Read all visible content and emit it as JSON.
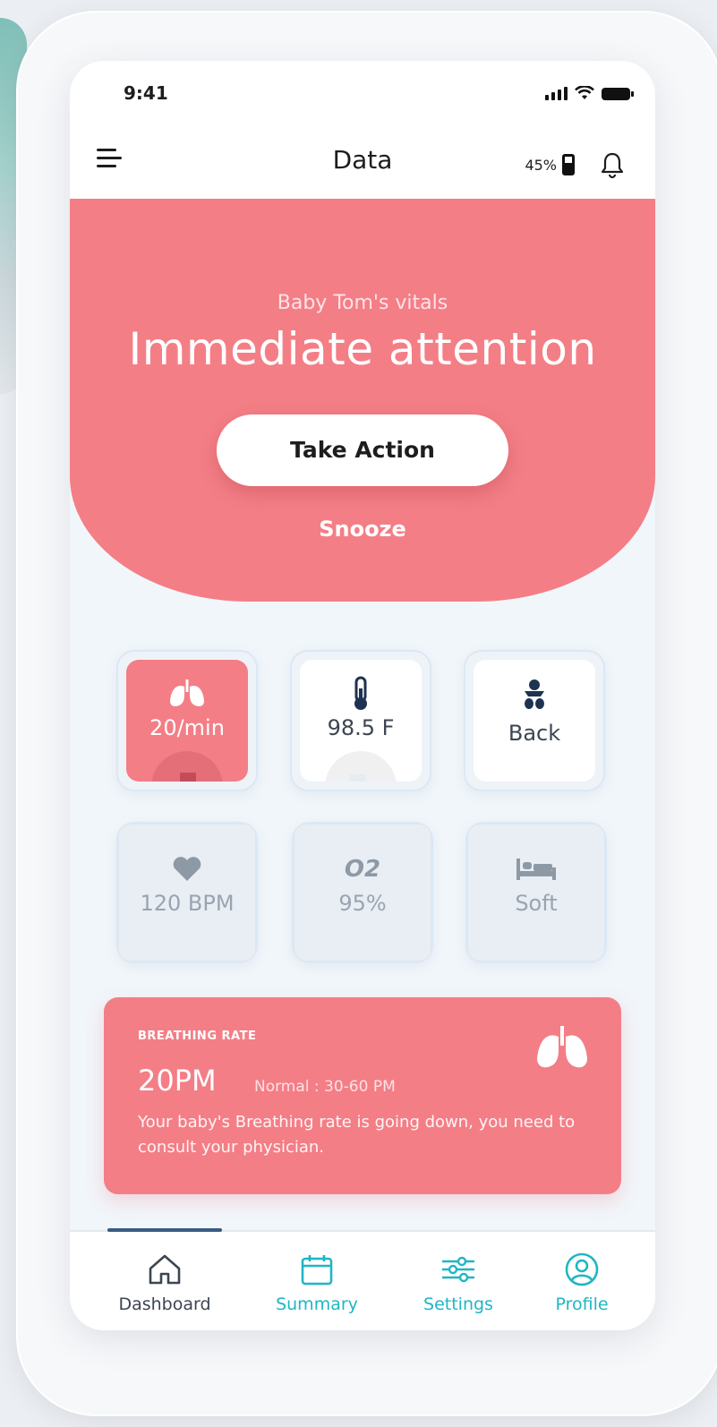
{
  "status_bar": {
    "time": "9:41"
  },
  "app_bar": {
    "title": "Data",
    "battery_percent": "45%"
  },
  "hero": {
    "subtitle": "Baby Tom's vitals",
    "title": "Immediate attention",
    "primary_action": "Take Action",
    "secondary_action": "Snooze",
    "color": "#f47e86"
  },
  "vitals": [
    {
      "icon": "lungs-icon",
      "value": "20/min",
      "state": "alert"
    },
    {
      "icon": "thermometer-icon",
      "value": "98.5 F",
      "state": "normal"
    },
    {
      "icon": "baby-icon",
      "value": "Back",
      "state": "normal"
    },
    {
      "icon": "heart-icon",
      "value": "120 BPM",
      "state": "muted"
    },
    {
      "icon": "o2-icon",
      "value": "95%",
      "icon_text": "O2",
      "state": "muted"
    },
    {
      "icon": "bed-icon",
      "value": "Soft",
      "state": "muted"
    }
  ],
  "alert_card": {
    "label": "BREATHING RATE",
    "value": "20PM",
    "normal_range": "Normal : 30-60 PM",
    "message": "Your baby's Breathing rate is going down, you need to consult your physician.",
    "icon": "lungs-icon"
  },
  "tabs": [
    {
      "label": "Dashboard",
      "icon": "home-icon",
      "active": true
    },
    {
      "label": "Summary",
      "icon": "calendar-icon",
      "active": false
    },
    {
      "label": "Settings",
      "icon": "sliders-icon",
      "active": false
    },
    {
      "label": "Profile",
      "icon": "user-circle-icon",
      "active": false
    }
  ],
  "colors": {
    "accent": "#f47e86",
    "teal": "#1fb6c4",
    "dark": "#3c4552"
  }
}
